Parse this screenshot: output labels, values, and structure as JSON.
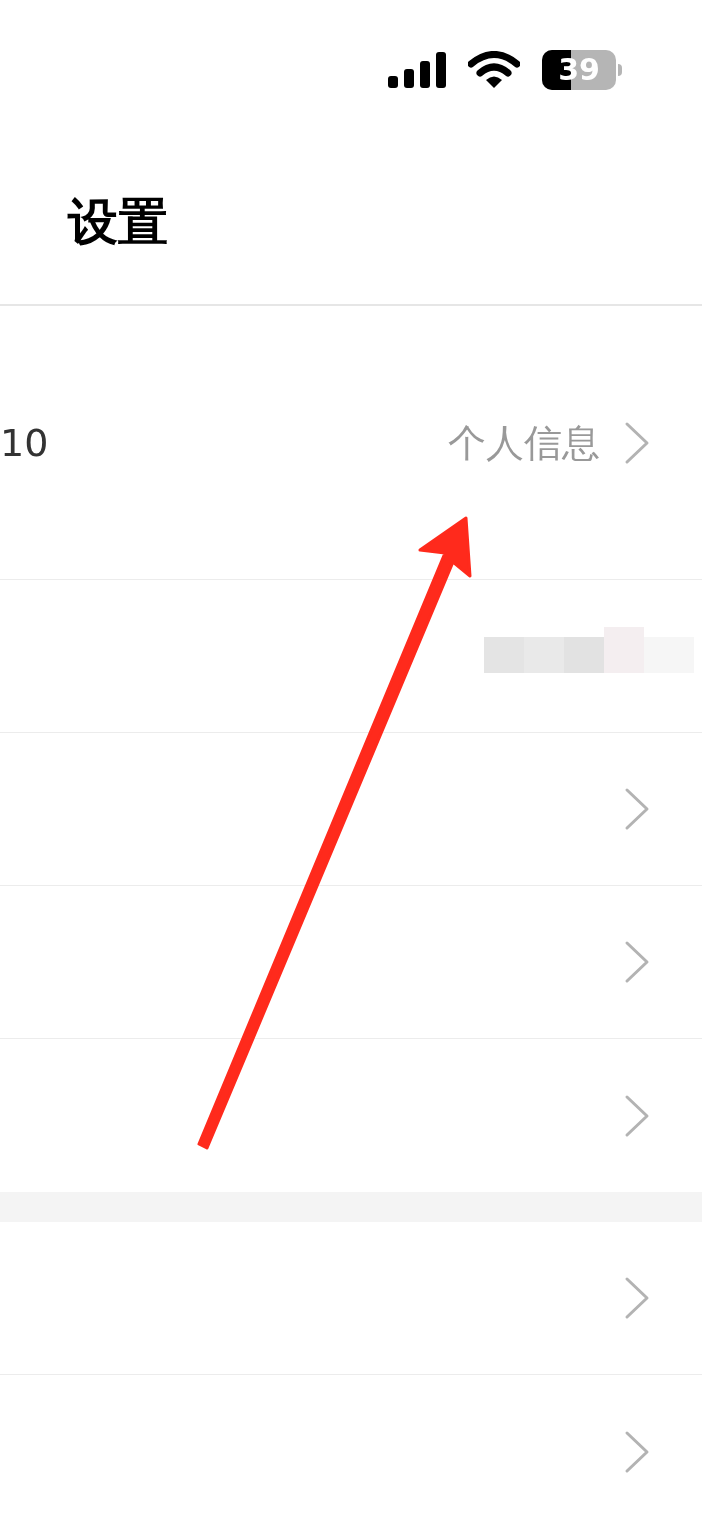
{
  "status_bar": {
    "battery": {
      "text": "39",
      "level": 0.39
    }
  },
  "title": "设置",
  "sections": [
    {
      "rows": [
        {
          "kind": "profile",
          "value": "10",
          "link": "个人信息"
        },
        {
          "kind": "blurred"
        },
        {
          "kind": "chevron"
        },
        {
          "kind": "chevron"
        },
        {
          "kind": "chevron"
        }
      ]
    },
    {
      "rows": [
        {
          "kind": "chevron"
        },
        {
          "kind": "chevron"
        }
      ]
    }
  ]
}
